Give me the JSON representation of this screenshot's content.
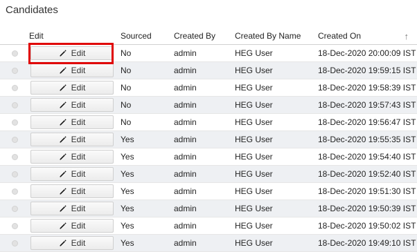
{
  "page": {
    "title": "Candidates"
  },
  "table": {
    "headers": {
      "edit": "Edit",
      "sourced": "Sourced",
      "created_by": "Created By",
      "created_by_name": "Created By Name",
      "created_on": "Created On"
    },
    "rows": [
      {
        "edit": "Edit",
        "sourced": "No",
        "created_by": "admin",
        "created_by_name": "HEG User",
        "created_on": "18-Dec-2020 20:00:09 IST"
      },
      {
        "edit": "Edit",
        "sourced": "No",
        "created_by": "admin",
        "created_by_name": "HEG User",
        "created_on": "18-Dec-2020 19:59:15 IST"
      },
      {
        "edit": "Edit",
        "sourced": "No",
        "created_by": "admin",
        "created_by_name": "HEG User",
        "created_on": "18-Dec-2020 19:58:39 IST"
      },
      {
        "edit": "Edit",
        "sourced": "No",
        "created_by": "admin",
        "created_by_name": "HEG User",
        "created_on": "18-Dec-2020 19:57:43 IST"
      },
      {
        "edit": "Edit",
        "sourced": "No",
        "created_by": "admin",
        "created_by_name": "HEG User",
        "created_on": "18-Dec-2020 19:56:47 IST"
      },
      {
        "edit": "Edit",
        "sourced": "Yes",
        "created_by": "admin",
        "created_by_name": "HEG User",
        "created_on": "18-Dec-2020 19:55:35 IST"
      },
      {
        "edit": "Edit",
        "sourced": "Yes",
        "created_by": "admin",
        "created_by_name": "HEG User",
        "created_on": "18-Dec-2020 19:54:40 IST"
      },
      {
        "edit": "Edit",
        "sourced": "Yes",
        "created_by": "admin",
        "created_by_name": "HEG User",
        "created_on": "18-Dec-2020 19:52:40 IST"
      },
      {
        "edit": "Edit",
        "sourced": "Yes",
        "created_by": "admin",
        "created_by_name": "HEG User",
        "created_on": "18-Dec-2020 19:51:30 IST"
      },
      {
        "edit": "Edit",
        "sourced": "Yes",
        "created_by": "admin",
        "created_by_name": "HEG User",
        "created_on": "18-Dec-2020 19:50:39 IST"
      },
      {
        "edit": "Edit",
        "sourced": "Yes",
        "created_by": "admin",
        "created_by_name": "HEG User",
        "created_on": "18-Dec-2020 19:50:02 IST"
      },
      {
        "edit": "Edit",
        "sourced": "Yes",
        "created_by": "admin",
        "created_by_name": "HEG User",
        "created_on": "18-Dec-2020 19:49:10 IST"
      }
    ]
  },
  "icons": {
    "edit": "pencil-icon",
    "sort": "sort-arrow-up-icon"
  },
  "colors": {
    "highlight": "#e00000",
    "stripe": "#eef0f3"
  }
}
